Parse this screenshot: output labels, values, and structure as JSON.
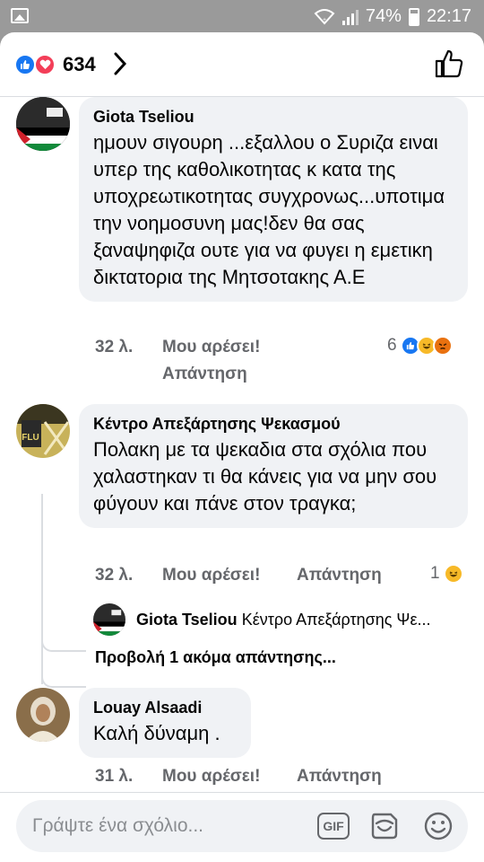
{
  "status_bar": {
    "battery": "74%",
    "time": "22:17"
  },
  "header": {
    "reaction_count": "634"
  },
  "comments": [
    {
      "author": "Giota Tseliou",
      "text": "ημουν σιγουρη ...εξαλλου ο Συριζα ειναι υπερ της καθολικοτητας κ κατα της υποχρεωτικοτητας συγχρονως...υποτιμα την νοημοσυνη μας!δεν θα σας ξαναψηφιζα ουτε για να φυγει η εμετικη δικτατορια της Μητσοτακης Α.Ε",
      "time": "32 λ.",
      "like": "Μου αρέσει!",
      "reply": "Απάντηση",
      "reaction_count": "6"
    },
    {
      "author": "Κέντρο Απεξάρτησης Ψεκασμού",
      "text": "Πολακη με τα ψεκαδια στα σχόλια που χαλαστηκαν τι θα κάνεις για να μην σου φύγουν και πάνε στον τραγκα;",
      "time": "32 λ.",
      "like": "Μου αρέσει!",
      "reply": "Απάντηση",
      "reaction_count": "1",
      "reply_preview": {
        "author": "Giota Tseliou",
        "text": "Κέντρο Απεξάρτησης Ψε..."
      },
      "more_replies": "Προβολή 1 ακόμα απάντησης..."
    },
    {
      "author": "Louay Alsaadi",
      "text": "Καλή δύναμη .",
      "time": "31 λ.",
      "like": "Μου αρέσει!",
      "reply": "Απάντηση"
    }
  ],
  "composer": {
    "placeholder": "Γράψτε ένα σχόλιο...",
    "gif_label": "GIF"
  },
  "colors": {
    "accent": "#1877f2",
    "love": "#f33e58",
    "haha": "#f7b928",
    "angry": "#e9710f",
    "bubble": "#f0f2f5",
    "muted": "#65676b"
  }
}
